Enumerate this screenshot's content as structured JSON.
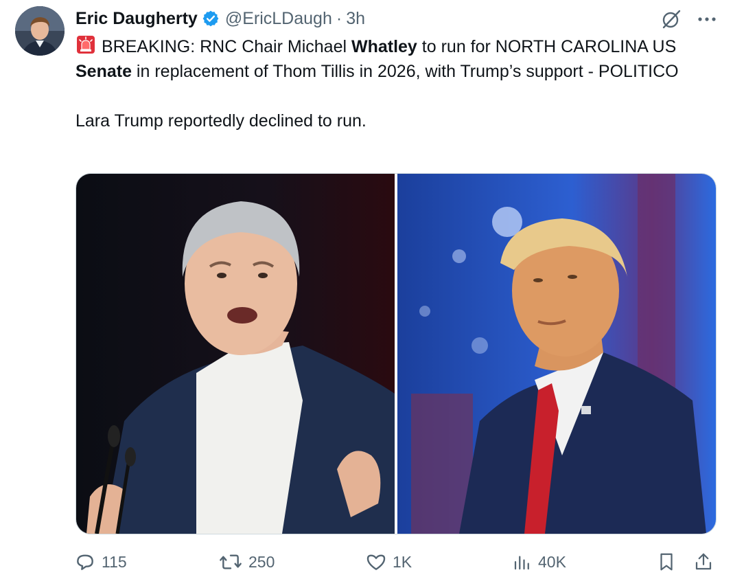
{
  "author": {
    "name": "Eric Daugherty",
    "handle": "@EricLDaugh",
    "separator": "·",
    "time": "3h",
    "verified": true,
    "verified_color": "#1d9bf0"
  },
  "tweet": {
    "line1_prefix": "BREAKING: RNC Chair Michael ",
    "line1_bold1": "Whatley",
    "line1_mid": " to run for NORTH CAROLINA US ",
    "line1_bold2": "Senate",
    "line1_suffix": " in replacement of Thom Tillis in 2026, with Trump’s support - POLITICO",
    "line2": "Lara Trump reportedly declined to run.",
    "emoji": "siren-emoji"
  },
  "icons": {
    "grok": "grok-icon",
    "more": "more-icon",
    "reply": "reply-icon",
    "retweet": "retweet-icon",
    "like": "like-icon",
    "views": "views-icon",
    "bookmark": "bookmark-icon",
    "share": "share-icon"
  },
  "stats": {
    "replies": "115",
    "retweets": "250",
    "likes": "1K",
    "views": "40K"
  },
  "colors": {
    "text": "#0f1419",
    "muted": "#536471",
    "siren": "#e0313b"
  }
}
